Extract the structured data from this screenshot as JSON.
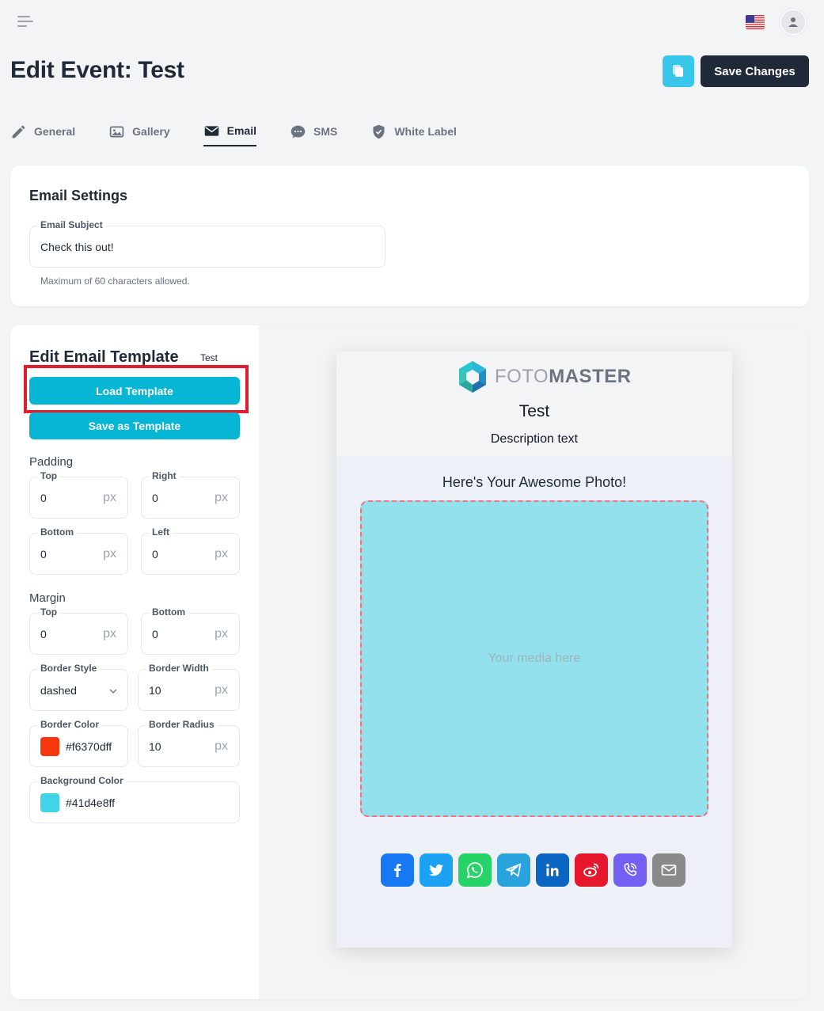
{
  "header": {
    "title": "Edit Event: Test",
    "save_label": "Save Changes"
  },
  "tabs": [
    {
      "label": "General",
      "icon": "pencil-icon"
    },
    {
      "label": "Gallery",
      "icon": "image-icon"
    },
    {
      "label": "Email",
      "icon": "envelope-icon",
      "active": true
    },
    {
      "label": "SMS",
      "icon": "chat-icon"
    },
    {
      "label": "White Label",
      "icon": "shield-icon"
    }
  ],
  "email_settings": {
    "title": "Email Settings",
    "subject_label": "Email Subject",
    "subject_value": "Check this out!",
    "helper": "Maximum of 60 characters allowed."
  },
  "template": {
    "title": "Edit Email Template",
    "badge": "Test",
    "load_label": "Load Template",
    "save_label": "Save as Template",
    "padding_label": "Padding",
    "margin_label": "Margin",
    "unit": "px",
    "padding": {
      "top_label": "Top",
      "top": "0",
      "right_label": "Right",
      "right": "0",
      "bottom_label": "Bottom",
      "bottom": "0",
      "left_label": "Left",
      "left": "0"
    },
    "margin": {
      "top_label": "Top",
      "top": "0",
      "bottom_label": "Bottom",
      "bottom": "0"
    },
    "border_style_label": "Border Style",
    "border_style": "dashed",
    "border_width_label": "Border Width",
    "border_width": "10",
    "border_color_label": "Border Color",
    "border_color": "#f6370dff",
    "border_radius_label": "Border Radius",
    "border_radius": "10",
    "background_color_label": "Background Color",
    "background_color": "#41d4e8ff"
  },
  "preview": {
    "logo_light": "FOTO",
    "logo_bold": "MASTER",
    "title": "Test",
    "description": "Description text",
    "heading": "Here's Your Awesome Photo!",
    "media_placeholder": "Your media here",
    "share_buttons": [
      {
        "name": "facebook",
        "color": "#1877f2"
      },
      {
        "name": "twitter",
        "color": "#1da1f2"
      },
      {
        "name": "whatsapp",
        "color": "#25d366"
      },
      {
        "name": "telegram",
        "color": "#2aa3dc"
      },
      {
        "name": "linkedin",
        "color": "#0a66c2"
      },
      {
        "name": "weibo",
        "color": "#e6162d"
      },
      {
        "name": "viber",
        "color": "#7360f2"
      },
      {
        "name": "email",
        "color": "#8a8a8a"
      }
    ]
  },
  "colors": {
    "accent": "#06b6d4",
    "dark": "#1f2937",
    "swatch_border": "#f6370d",
    "swatch_background": "#41d4e8"
  }
}
